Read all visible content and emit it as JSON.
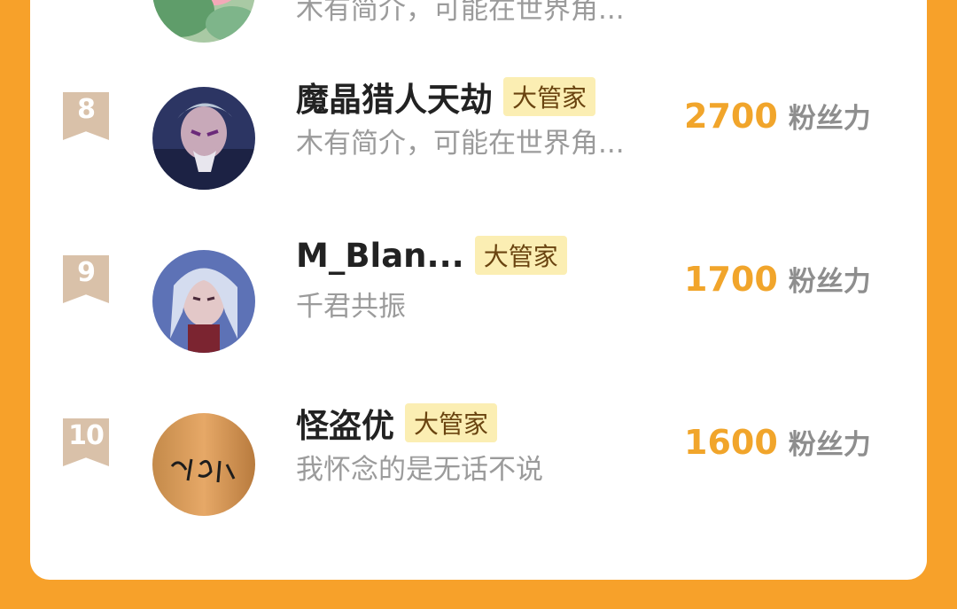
{
  "ranking": {
    "partial_row": {
      "bio": "木有简介，可能在世界角..."
    },
    "rows": [
      {
        "rank": "8",
        "name": "魔晶猎人天劫",
        "badge": "大管家",
        "bio": "木有简介，可能在世界角...",
        "score": "2700",
        "unit": "粉丝力"
      },
      {
        "rank": "9",
        "name": "M_Blan...",
        "badge": "大管家",
        "bio": "千君共振",
        "score": "1700",
        "unit": "粉丝力"
      },
      {
        "rank": "10",
        "name": "怪盗优",
        "badge": "大管家",
        "bio": "我怀念的是无话不说",
        "score": "1600",
        "unit": "粉丝力"
      }
    ]
  },
  "colors": {
    "background": "#f7a12a",
    "card": "#ffffff",
    "score": "#f1a52b",
    "badge_bg": "#fbeeb3",
    "rank_badge": "#d9c1a9"
  }
}
